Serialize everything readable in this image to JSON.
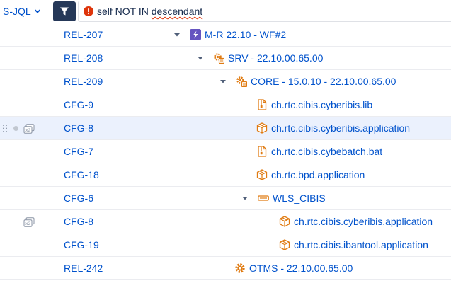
{
  "toolbar": {
    "mode_label": "S-JQL",
    "query_prefix": "self NOT IN ",
    "query_flagged": "descendant"
  },
  "rows": [
    {
      "key": "REL-207",
      "title": "M-R 22.10 - WF#2",
      "icon": "bolt-icon",
      "expanded": true
    },
    {
      "key": "REL-208",
      "title": "SRV - 22.10.00.65.00",
      "icon": "gear-package-icon",
      "expanded": true
    },
    {
      "key": "REL-209",
      "title": "CORE - 15.0.10 - 22.10.00.65.00",
      "icon": "gear-package-icon",
      "expanded": true
    },
    {
      "key": "CFG-9",
      "title": "ch.rtc.cibis.cyberibis.lib",
      "icon": "zip-file-icon"
    },
    {
      "key": "CFG-8",
      "title": "ch.rtc.cibis.cyberibis.application",
      "icon": "box-icon",
      "selected": true,
      "multi_badge": "x2"
    },
    {
      "key": "CFG-7",
      "title": "ch.rtc.cibis.cybebatch.bat",
      "icon": "zip-file-icon"
    },
    {
      "key": "CFG-18",
      "title": "ch.rtc.bpd.application",
      "icon": "box-icon"
    },
    {
      "key": "CFG-6",
      "title": "WLS_CIBIS",
      "icon": "server-icon",
      "expanded": true
    },
    {
      "key": "CFG-8",
      "title": "ch.rtc.cibis.cyberibis.application",
      "icon": "box-icon",
      "multi_badge": "x2"
    },
    {
      "key": "CFG-19",
      "title": "ch.rtc.cibis.ibantool.application",
      "icon": "box-icon"
    },
    {
      "key": "REL-242",
      "title": "OTMS - 22.10.00.65.00",
      "icon": "gear-icon"
    }
  ],
  "colors": {
    "link": "#0052cc",
    "selected_row": "#ebf1fd",
    "orange_icon": "#e07b12",
    "purple_icon": "#6554c0",
    "error": "#de350b"
  }
}
